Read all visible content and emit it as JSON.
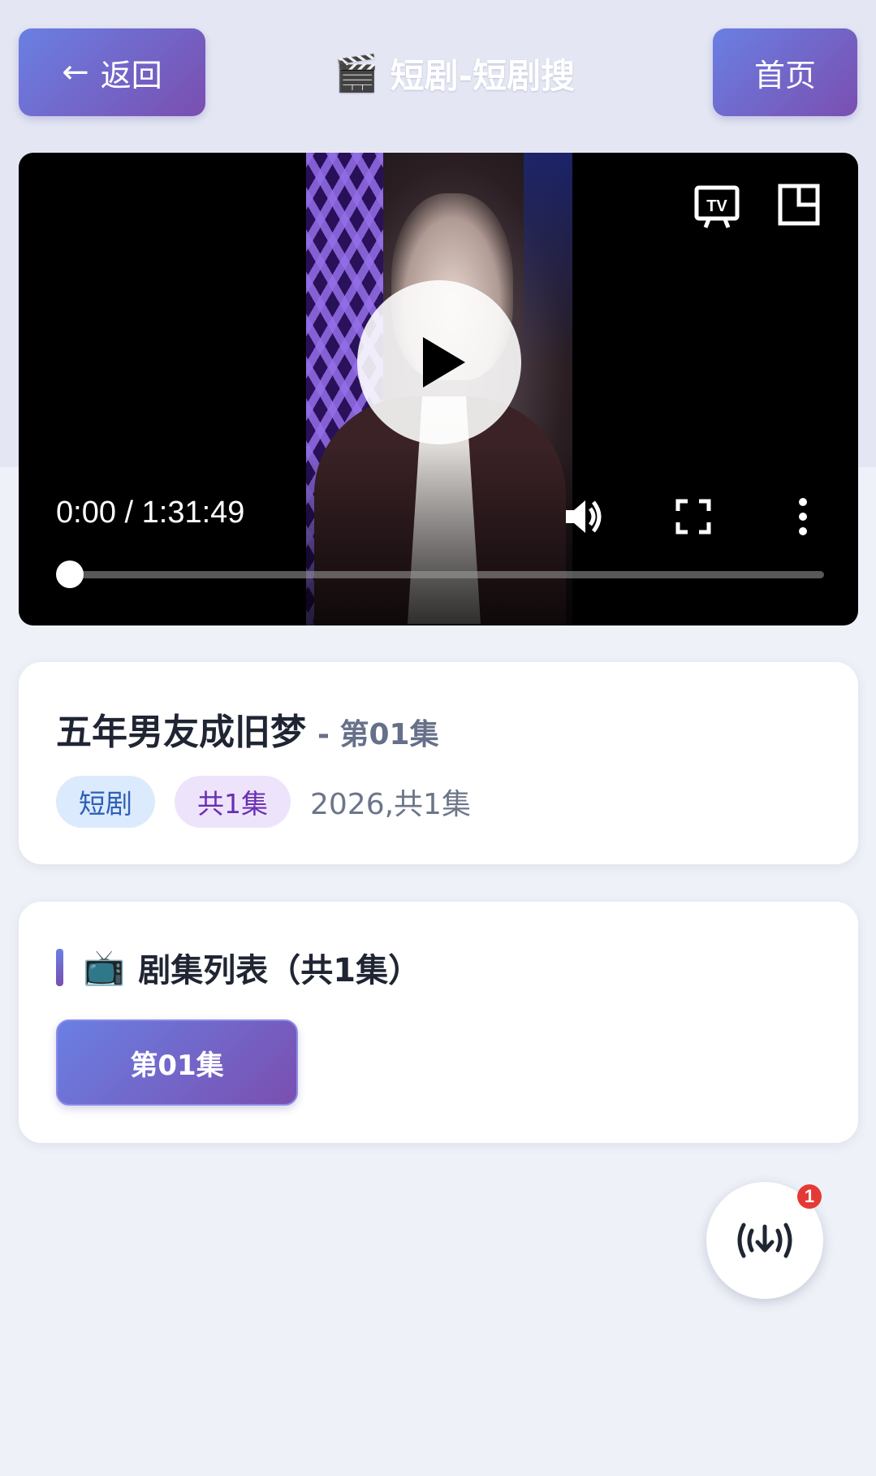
{
  "header": {
    "back_label": "返回",
    "title": "短剧-短剧搜",
    "title_icon": "🎬",
    "home_label": "首页"
  },
  "player": {
    "time_display": "0:00 / 1:31:49",
    "progress": 0,
    "icons": [
      "cast-tv-icon",
      "picture-in-picture-icon",
      "play-icon",
      "volume-icon",
      "fullscreen-icon",
      "more-vertical-icon"
    ]
  },
  "info": {
    "title": "五年男友成旧梦",
    "episode_suffix": "- 第01集",
    "tag_genre": "短剧",
    "tag_count": "共1集",
    "meta": "2026,共1集"
  },
  "episodes": {
    "header_icon": "📺",
    "header_title": "剧集列表（共1集）",
    "items": [
      {
        "label": "第01集",
        "active": true
      }
    ]
  },
  "fab": {
    "icon": "download-signal-icon",
    "badge": "1"
  },
  "colors": {
    "accent_start": "#6a7fe3",
    "accent_end": "#7a4fb0",
    "badge_red": "#e53935"
  }
}
